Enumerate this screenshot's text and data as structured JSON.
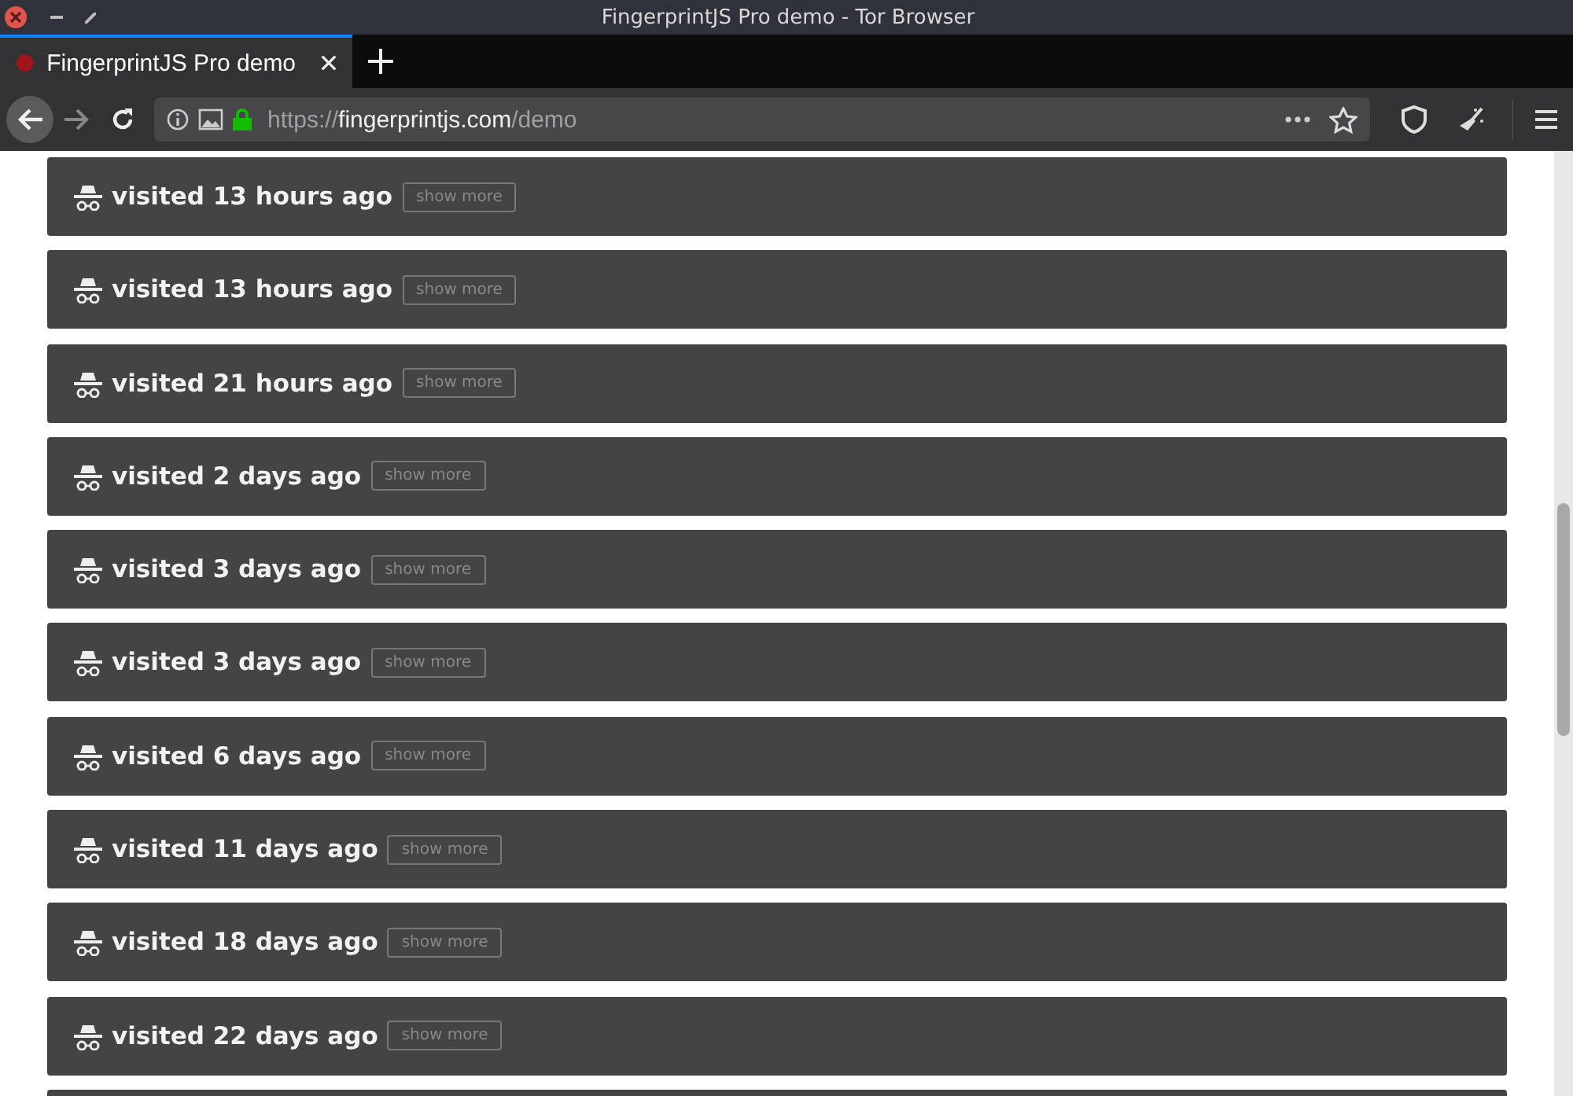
{
  "window": {
    "title": "FingerprintJS Pro demo - Tor Browser"
  },
  "tabs": [
    {
      "label": "FingerprintJS Pro demo",
      "selected": true
    }
  ],
  "address_bar": {
    "scheme": "https://",
    "host": "fingerprintjs.com",
    "path": "/demo"
  },
  "visits": [
    {
      "label": "visited 13 hours ago",
      "button": "show more"
    },
    {
      "label": "visited 13 hours ago",
      "button": "show more"
    },
    {
      "label": "visited 21 hours ago",
      "button": "show more"
    },
    {
      "label": "visited 2 days ago",
      "button": "show more"
    },
    {
      "label": "visited 3 days ago",
      "button": "show more"
    },
    {
      "label": "visited 3 days ago",
      "button": "show more"
    },
    {
      "label": "visited 6 days ago",
      "button": "show more"
    },
    {
      "label": "visited 11 days ago",
      "button": "show more"
    },
    {
      "label": "visited 18 days ago",
      "button": "show more"
    },
    {
      "label": "visited 22 days ago",
      "button": "show more"
    }
  ]
}
